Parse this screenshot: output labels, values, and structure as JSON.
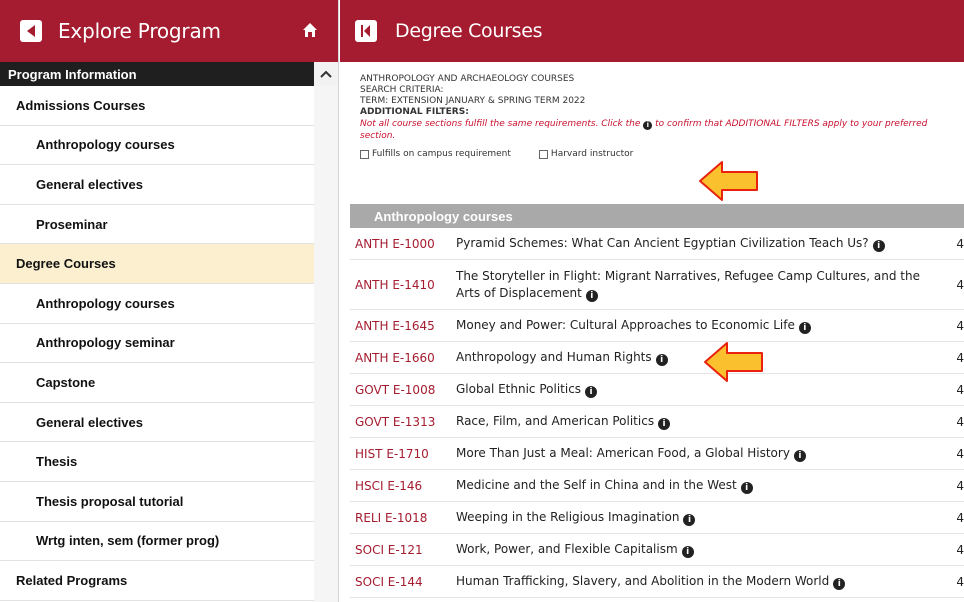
{
  "left_panel": {
    "title": "Explore Program",
    "program_info": "Program Information",
    "items": [
      {
        "label": "Admissions Courses",
        "level": 1
      },
      {
        "label": "Anthropology courses",
        "level": 2
      },
      {
        "label": "General electives",
        "level": 2
      },
      {
        "label": "Proseminar",
        "level": 2
      },
      {
        "label": "Degree Courses",
        "level": 1,
        "active": true
      },
      {
        "label": "Anthropology courses",
        "level": 2
      },
      {
        "label": "Anthropology seminar",
        "level": 2
      },
      {
        "label": "Capstone",
        "level": 2
      },
      {
        "label": "General electives",
        "level": 2
      },
      {
        "label": "Thesis",
        "level": 2
      },
      {
        "label": "Thesis proposal tutorial",
        "level": 2
      },
      {
        "label": "Wrtg inten, sem (former prog)",
        "level": 2
      },
      {
        "label": "Related Programs",
        "level": 1
      }
    ]
  },
  "right_panel": {
    "title": "Degree Courses",
    "heading": "ANTHROPOLOGY AND ARCHAEOLOGY COURSES",
    "search_criteria": "SEARCH CRITERIA:",
    "term": "TERM: EXTENSION JANUARY & SPRING TERM 2022",
    "additional_filters": "ADDITIONAL FILTERS:",
    "warning_before": "Not all course sections fulfill the same requirements. Click the",
    "warning_after": "to confirm that ADDITIONAL FILTERS apply to your preferred section.",
    "filters": [
      "Fulfills on campus requirement",
      "Harvard instructor"
    ],
    "section_header": "Anthropology courses",
    "courses": [
      {
        "code": "ANTH E-1000",
        "title": "Pyramid Schemes: What Can Ancient Egyptian Civilization Teach Us?",
        "credits": "4"
      },
      {
        "code": "ANTH E-1410",
        "title": "The Storyteller in Flight: Migrant Narratives, Refugee Camp Cultures, and the Arts of Displacement",
        "credits": "4"
      },
      {
        "code": "ANTH E-1645",
        "title": "Money and Power: Cultural Approaches to Economic Life",
        "credits": "4"
      },
      {
        "code": "ANTH E-1660",
        "title": "Anthropology and Human Rights",
        "credits": "4"
      },
      {
        "code": "GOVT E-1008",
        "title": "Global Ethnic Politics",
        "credits": "4"
      },
      {
        "code": "GOVT E-1313",
        "title": "Race, Film, and American Politics",
        "credits": "4"
      },
      {
        "code": "HIST E-1710",
        "title": "More Than Just a Meal: American Food, a Global History",
        "credits": "4"
      },
      {
        "code": "HSCI E-146",
        "title": "Medicine and the Self in China and in the West",
        "credits": "4"
      },
      {
        "code": "RELI E-1018",
        "title": "Weeping in the Religious Imagination",
        "credits": "4"
      },
      {
        "code": "SOCI E-121",
        "title": "Work, Power, and Flexible Capitalism",
        "credits": "4"
      },
      {
        "code": "SOCI E-144",
        "title": "Human Trafficking, Slavery, and Abolition in the Modern World",
        "credits": "4"
      }
    ]
  },
  "colors": {
    "brand": "#a51c30",
    "active_bg": "#fbefd0",
    "arrow_fill": "#fbc02d",
    "arrow_stroke": "#e8220c"
  },
  "icons": {
    "info": "i"
  }
}
